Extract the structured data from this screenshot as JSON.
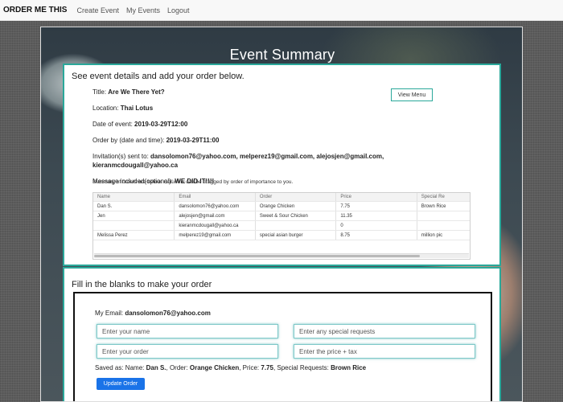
{
  "navbar": {
    "brand": "ORDER ME THIS",
    "links": [
      "Create Event",
      "My Events",
      "Logout"
    ]
  },
  "hero": {
    "title": "Event Summary"
  },
  "details_panel": {
    "heading": "See event details and add your order below.",
    "view_menu_label": "View Menu",
    "title_label": "Title:",
    "title_value": "Are We There Yet?",
    "location_label": "Location:",
    "location_value": "Thai Lotus",
    "date_label": "Date of event:",
    "date_value": "2019-03-29T12:00",
    "order_by_label": "Order by (date and time):",
    "order_by_value": "2019-03-29T11:00",
    "invitations_label": "Invitation(s) sent to:",
    "invitations_value": "dansolomon76@yahoo.com, melperez19@gmail.com, alejosjen@gmail.com, kieranmcdougall@yahoo.ca",
    "message_label": "Message included(optional):",
    "message_value": "WE DID IT!!!!",
    "summary_note": "Summary of orders are below. Columns can be dragged by order of importance to you."
  },
  "orders_grid": {
    "columns": [
      "Name",
      "Email",
      "Order",
      "Price",
      "Special Re"
    ],
    "rows": [
      [
        "Dan S.",
        "dansolomon76@yahoo.com",
        "Orange Chicken",
        "7.75",
        "Brown Rice"
      ],
      [
        "Jen",
        "alejosjen@gmail.com",
        "Sweet & Sour Chicken",
        "11.35",
        ""
      ],
      [
        "",
        "kieranmcdougall@yahoo.ca",
        "",
        "0",
        ""
      ],
      [
        "Melissa Perez",
        "melperez19@gmail.com",
        "special asian burger",
        "8.75",
        "million pic"
      ]
    ]
  },
  "form_panel": {
    "heading": "Fill in the blanks to make your order",
    "my_email_label": "My Email:",
    "my_email_value": "dansolomon76@yahoo.com",
    "name_placeholder": "Enter your name",
    "requests_placeholder": "Enter any special requests",
    "order_placeholder": "Enter your order",
    "price_placeholder": "Enter the price + tax",
    "saved_as_label": "Saved as: Name:",
    "saved_name": "Dan S.",
    "saved_order_label": ", Order:",
    "saved_order": "Orange Chicken",
    "saved_price_label": ", Price:",
    "saved_price": "7.75",
    "saved_requests_label": ", Special Requests:",
    "saved_requests": "Brown Rice",
    "update_button_label": "Update Order"
  },
  "colors": {
    "accent_teal": "#2aa89a",
    "primary_blue": "#1a73e8"
  }
}
